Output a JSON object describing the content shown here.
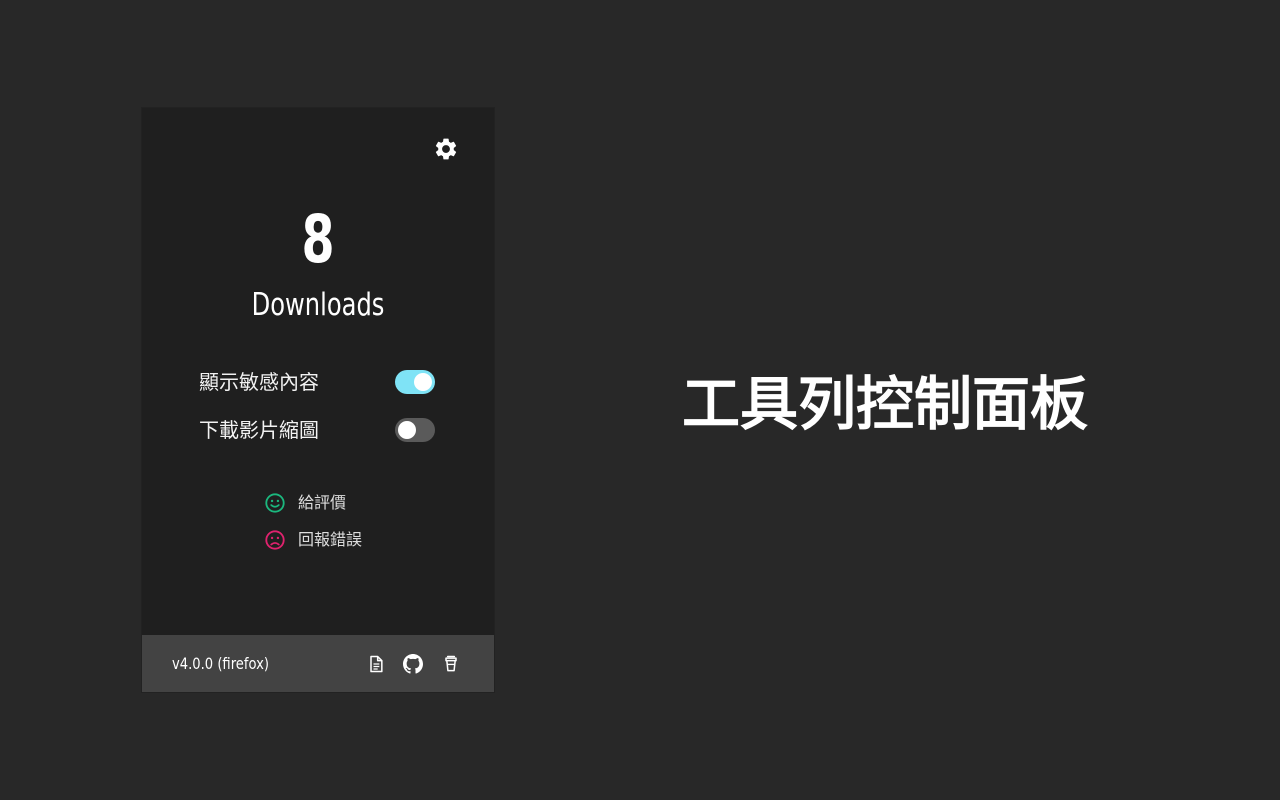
{
  "popup": {
    "settings_icon": "gear-icon",
    "download_count": "8",
    "download_label": "Downloads",
    "options": [
      {
        "label": "顯示敏感內容",
        "enabled": true
      },
      {
        "label": "下載影片縮圖",
        "enabled": false
      }
    ],
    "links": [
      {
        "label": "給評價",
        "icon": "smile-icon",
        "color": "#1bb87e"
      },
      {
        "label": "回報錯誤",
        "icon": "frown-icon",
        "color": "#e0226e"
      }
    ],
    "footer": {
      "version": "v4.0.0 (firefox)",
      "icons": [
        "document-icon",
        "github-icon",
        "coffee-cup-icon"
      ]
    },
    "colors": {
      "toggle_on": "#7fe3f6",
      "toggle_off": "#5a5a5a",
      "panel_bg": "#1f1f1f",
      "footer_bg": "#434343"
    }
  },
  "caption": "工具列控制面板"
}
